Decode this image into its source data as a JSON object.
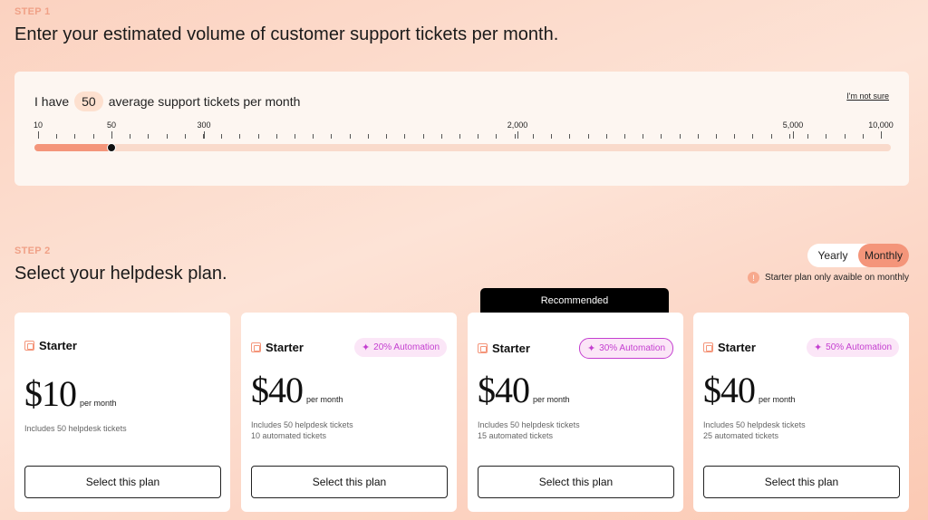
{
  "step1": {
    "label": "STEP 1",
    "title": "Enter your estimated volume of customer support tickets per month.",
    "prefix": "I have",
    "value": "50",
    "suffix": "average support tickets per month",
    "not_sure": "I'm not sure",
    "tick_labels": [
      "10",
      "50",
      "300",
      "2,000",
      "5,000",
      "10,000"
    ],
    "slider_fraction": 0.09
  },
  "step2": {
    "label": "STEP 2",
    "title": "Select your helpdesk plan.",
    "billing": {
      "yearly": "Yearly",
      "monthly": "Monthly",
      "selected": "Monthly"
    },
    "note": "Starter plan only avaible on monthly",
    "note_icon": "!",
    "recommended": "Recommended"
  },
  "plans": [
    {
      "name": "Starter",
      "price": "$10",
      "per": "per month",
      "desc1": "Includes 50 helpdesk tickets",
      "desc2": "",
      "badge": "",
      "button": "Select this plan"
    },
    {
      "name": "Starter",
      "price": "$40",
      "per": "per month",
      "desc1": "Includes 50 helpdesk tickets",
      "desc2": "10 automated tickets",
      "badge": "20% Automation",
      "button": "Select this plan"
    },
    {
      "name": "Starter",
      "price": "$40",
      "per": "per month",
      "desc1": "Includes 50 helpdesk tickets",
      "desc2": "15 automated tickets",
      "badge": "30% Automation",
      "button": "Select this plan"
    },
    {
      "name": "Starter",
      "price": "$40",
      "per": "per month",
      "desc1": "Includes 50 helpdesk tickets",
      "desc2": "25 automated tickets",
      "badge": "50% Automation",
      "button": "Select this plan"
    }
  ],
  "colors": {
    "accent": "#f4957a",
    "automation": "#c43fd0",
    "step_label": "#f0a187"
  }
}
